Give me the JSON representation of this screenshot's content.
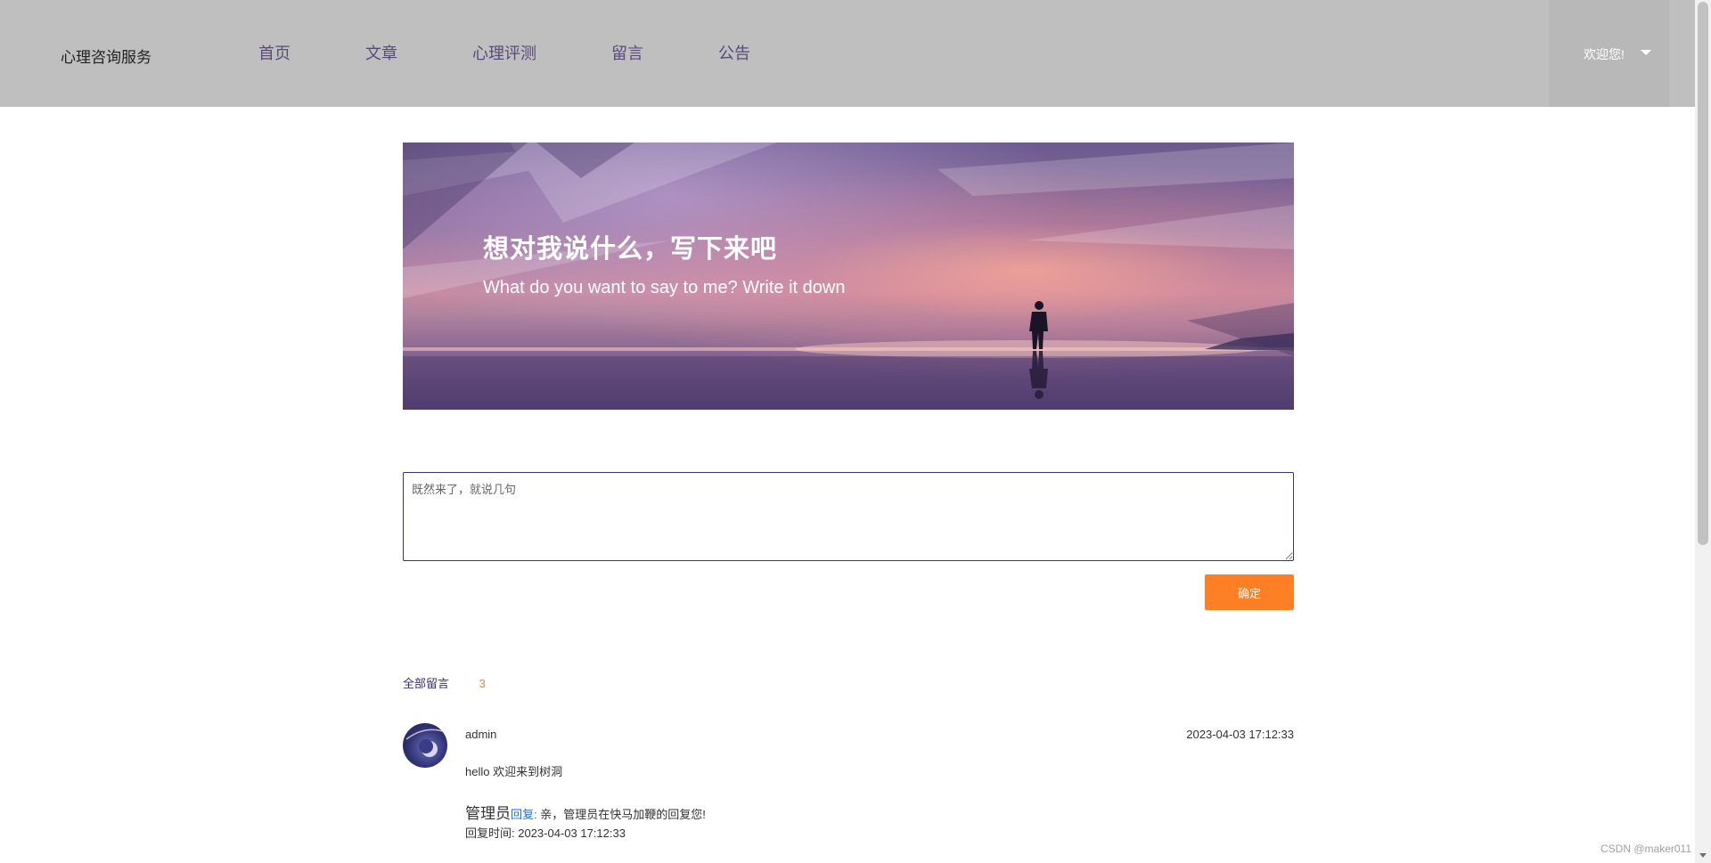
{
  "header": {
    "brand": "心理咨询服务",
    "nav": [
      "首页",
      "文章",
      "心理评测",
      "留言",
      "公告"
    ],
    "user_menu": {
      "welcome": "欢迎您!",
      "icon": "caret-down-icon"
    }
  },
  "banner": {
    "title": "想对我说什么，写下来吧",
    "subtitle": "What do you want to say to me? Write it down"
  },
  "form": {
    "placeholder": "既然来了，就说几句",
    "value": "",
    "submit_label": "确定"
  },
  "comments_header": {
    "label": "全部留言",
    "count": "3"
  },
  "comments": [
    {
      "author": "admin",
      "time": "2023-04-03 17:12:33",
      "content": "hello 欢迎来到树洞",
      "reply": {
        "name": "管理员",
        "link_label": "回复:",
        "text": " 亲，管理员在快马加鞭的回复您!",
        "time_label": "回复时间: 2023-04-03 17:12:33"
      }
    }
  ],
  "watermark": "CSDN @maker011",
  "colors": {
    "header_bg": "#bfbfbf",
    "nav_text": "#5a4a78",
    "accent": "#ff7f24",
    "link": "#1a6fd8"
  }
}
